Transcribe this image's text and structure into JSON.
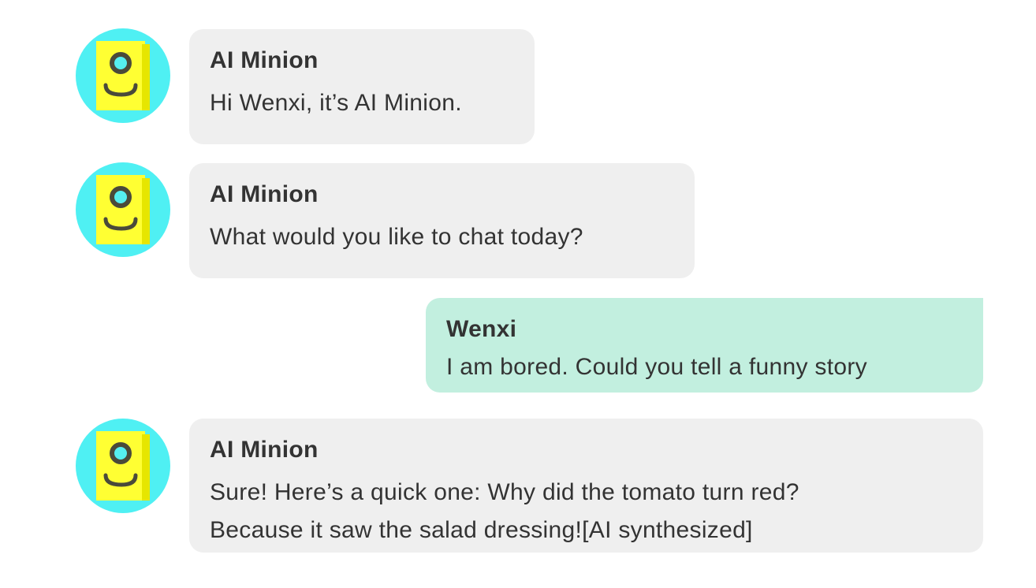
{
  "messages": [
    {
      "role": "bot",
      "sender": "AI Minion",
      "lines": [
        "Hi Wenxi, it’s AI Minion."
      ]
    },
    {
      "role": "bot",
      "sender": "AI Minion",
      "lines": [
        "What would you like to chat today?"
      ]
    },
    {
      "role": "user",
      "sender": "Wenxi",
      "lines": [
        "I am bored. Could you tell a funny story"
      ]
    },
    {
      "role": "bot",
      "sender": "AI Minion",
      "lines": [
        "Sure! Here’s a quick one: Why did the tomato turn red?",
        "Because it saw the salad dressing![AI synthesized]"
      ]
    }
  ],
  "colors": {
    "avatar_bg": "#4ff0f3",
    "avatar_face": "#ffff33",
    "bot_bubble": "#efefef",
    "user_bubble": "#c2efdf"
  },
  "icons": {
    "bot_avatar": "minion-face-icon"
  }
}
